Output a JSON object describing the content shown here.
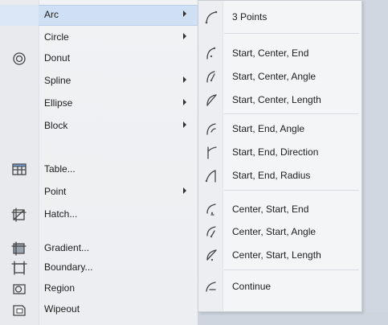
{
  "left_menu": {
    "items": [
      {
        "label": "Arc",
        "submenu": true,
        "icon": ""
      },
      {
        "label": "Circle",
        "submenu": true,
        "icon": ""
      },
      {
        "label": "Donut",
        "submenu": false,
        "icon": "donut-icon"
      },
      {
        "label": "Spline",
        "submenu": true,
        "icon": ""
      },
      {
        "label": "Ellipse",
        "submenu": true,
        "icon": ""
      },
      {
        "label": "Block",
        "submenu": true,
        "icon": ""
      },
      {
        "label": "Table...",
        "submenu": false,
        "icon": "table-icon"
      },
      {
        "label": "Point",
        "submenu": true,
        "icon": ""
      },
      {
        "label": "Hatch...",
        "submenu": false,
        "icon": "hatch-icon"
      },
      {
        "label": "Gradient...",
        "submenu": false,
        "icon": "gradient-icon"
      },
      {
        "label": "Boundary...",
        "submenu": false,
        "icon": "boundary-icon"
      },
      {
        "label": "Region",
        "submenu": false,
        "icon": "region-icon"
      },
      {
        "label": "Wipeout",
        "submenu": false,
        "icon": "wipeout-icon"
      }
    ]
  },
  "arc_submenu": {
    "items": [
      {
        "label": "3 Points",
        "icon": "arc-3points-icon"
      },
      {
        "label": "Start, Center, End",
        "icon": "arc-start-center-end-icon"
      },
      {
        "label": "Start, Center, Angle",
        "icon": "arc-start-center-angle-icon"
      },
      {
        "label": "Start, Center, Length",
        "icon": "arc-start-center-length-icon"
      },
      {
        "label": "Start, End, Angle",
        "icon": "arc-start-end-angle-icon"
      },
      {
        "label": "Start, End, Direction",
        "icon": "arc-start-end-direction-icon"
      },
      {
        "label": "Start, End, Radius",
        "icon": "arc-start-end-radius-icon"
      },
      {
        "label": "Center, Start, End",
        "icon": "arc-center-start-end-icon"
      },
      {
        "label": "Center, Start, Angle",
        "icon": "arc-center-start-angle-icon"
      },
      {
        "label": "Center, Start, Length",
        "icon": "arc-center-start-length-icon"
      },
      {
        "label": "Continue",
        "icon": "arc-continue-icon"
      }
    ]
  },
  "colors": {
    "highlight": "#cfe0f5",
    "menu_bg": "#f1f2f4",
    "accent": "#2e6ab1"
  }
}
